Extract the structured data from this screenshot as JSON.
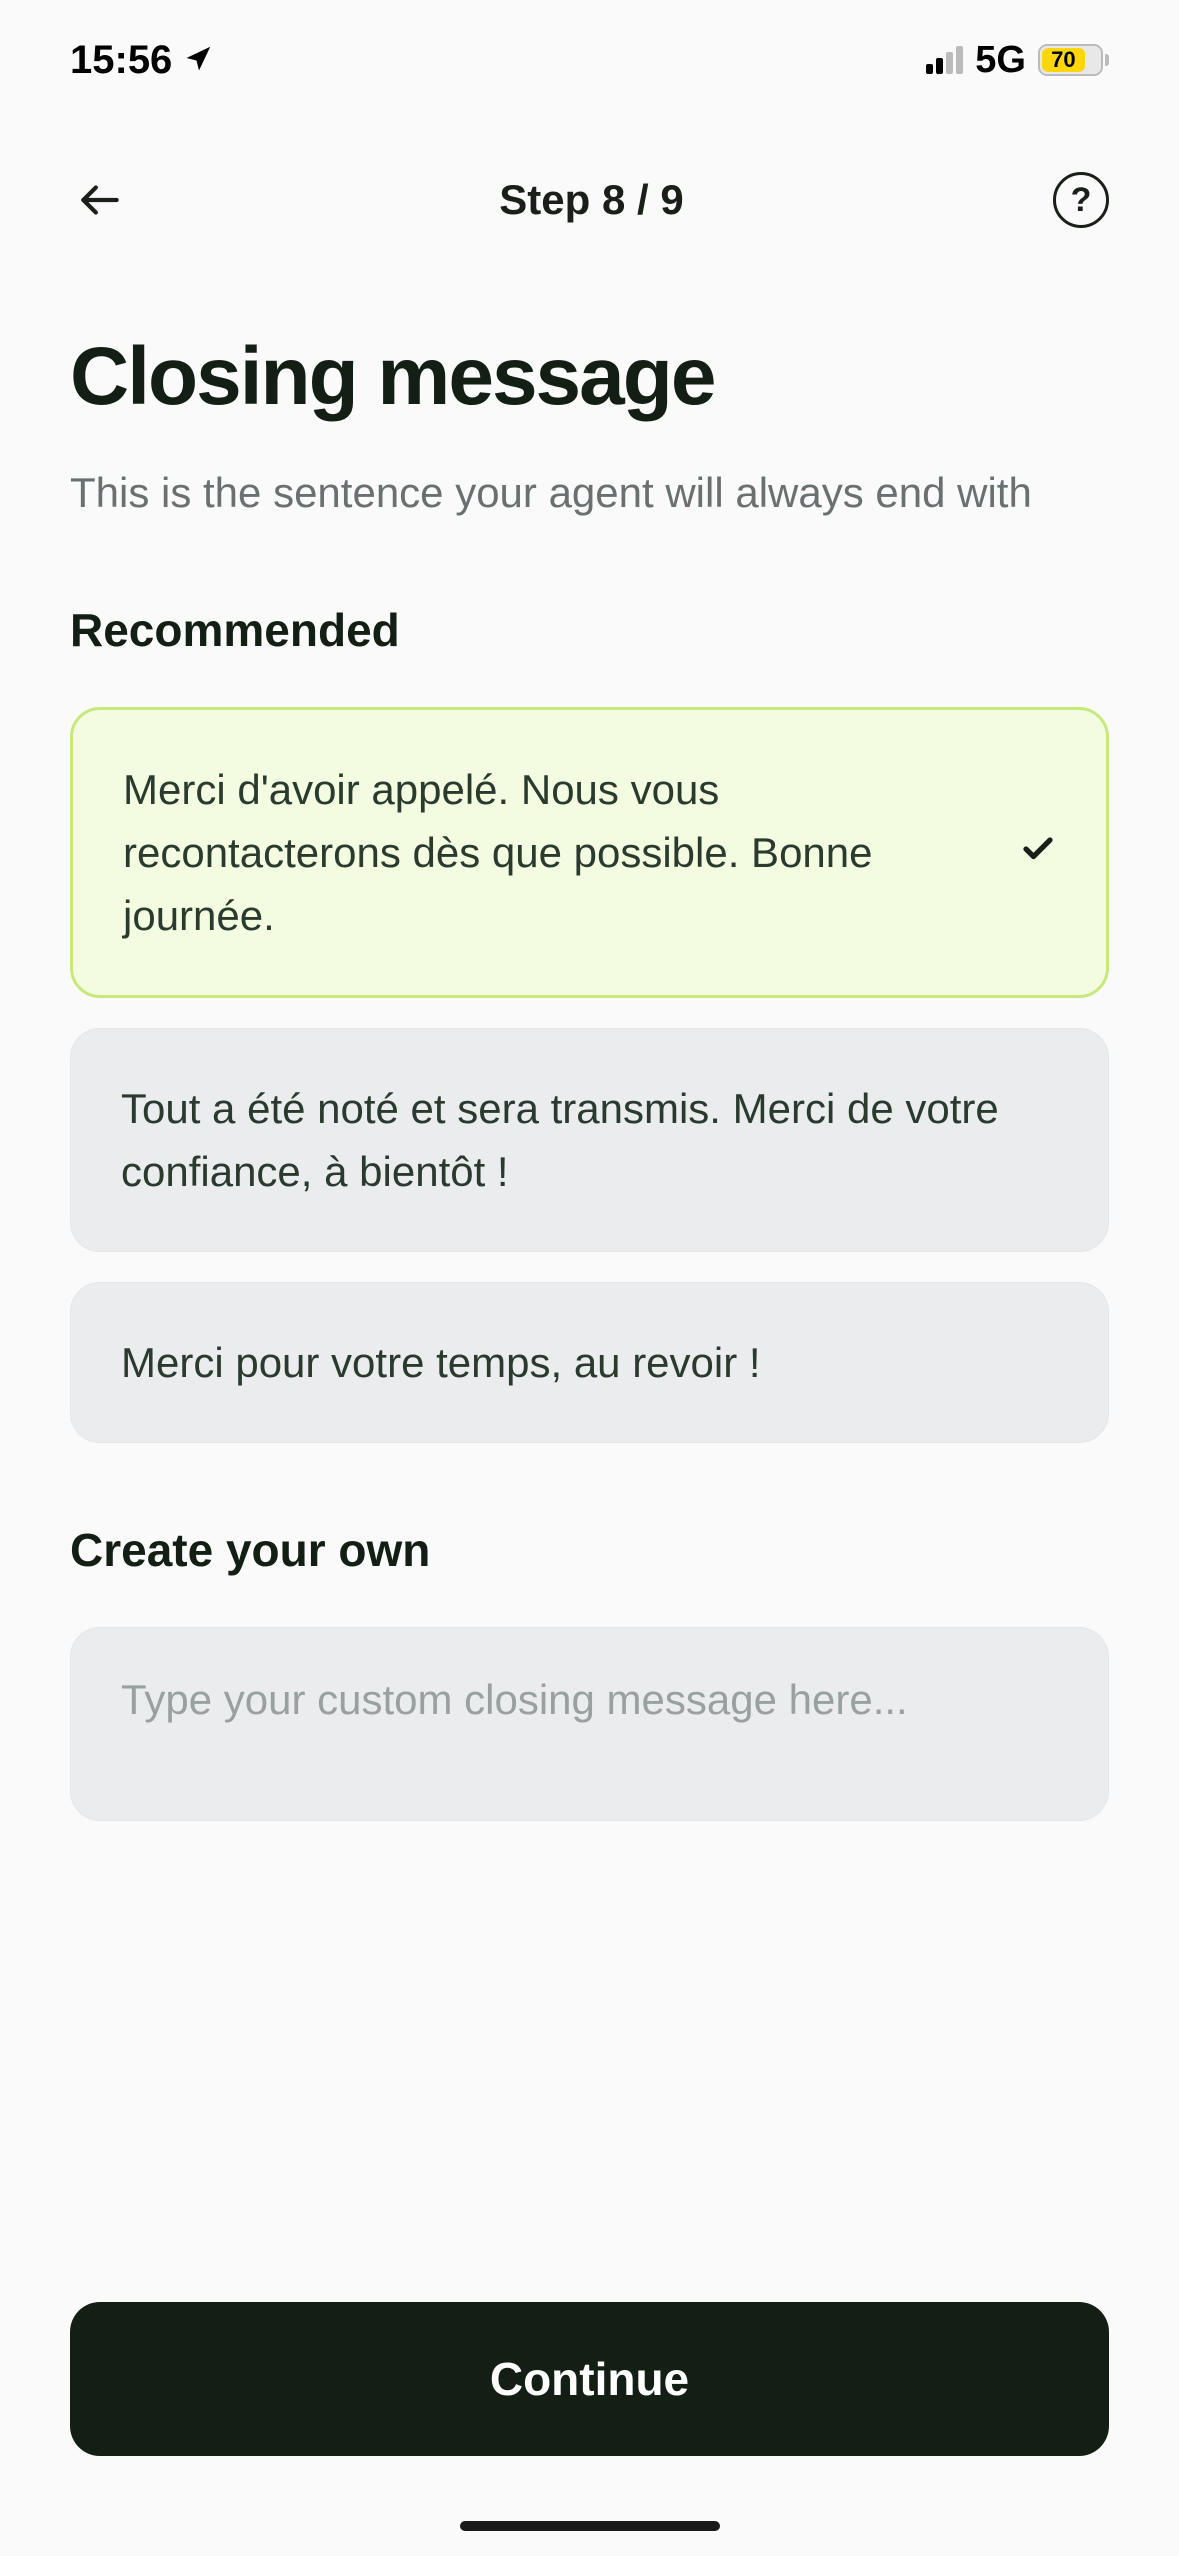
{
  "status_bar": {
    "time": "15:56",
    "network": "5G",
    "battery": "70"
  },
  "nav": {
    "step_label": "Step 8 / 9"
  },
  "page": {
    "title": "Closing message",
    "subtitle": "This is the sentence your agent will always end with"
  },
  "recommended": {
    "label": "Recommended",
    "options": [
      "Merci d'avoir appelé. Nous vous recontacterons dès que possible. Bonne journée.",
      "Tout a été noté et sera transmis. Merci de votre confiance, à bientôt !",
      "Merci pour votre temps, au revoir !"
    ],
    "selected_index": 0
  },
  "custom": {
    "label": "Create your own",
    "placeholder": "Type your custom closing message here..."
  },
  "footer": {
    "continue_label": "Continue"
  }
}
